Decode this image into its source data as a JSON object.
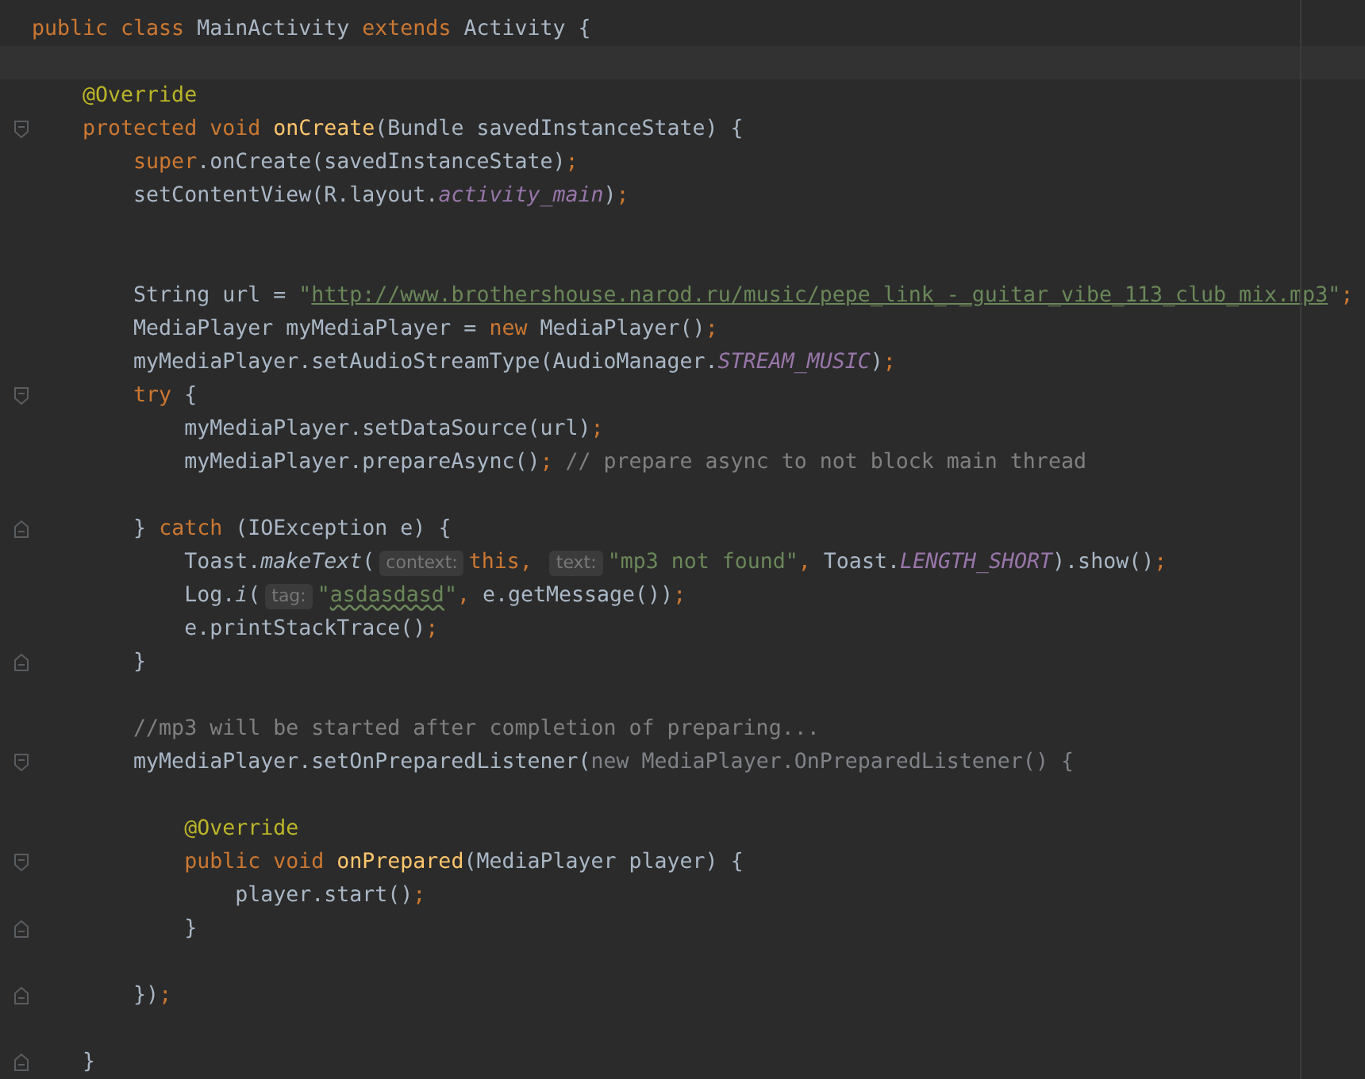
{
  "editor": {
    "lines": [
      {
        "kind": "line",
        "tokens": [
          {
            "kind": "keyword",
            "text": "public class "
          },
          {
            "kind": "plain",
            "text": "MainActivity "
          },
          {
            "kind": "keyword",
            "text": "extends "
          },
          {
            "kind": "plain",
            "text": "Activity {"
          }
        ]
      },
      {
        "kind": "caret-line"
      },
      {
        "kind": "line",
        "tokens": [
          {
            "kind": "annotation",
            "text": "    @Override"
          }
        ]
      },
      {
        "kind": "line",
        "fold": {
          "kind": "start"
        },
        "tokens": [
          {
            "kind": "keyword",
            "text": "    protected void "
          },
          {
            "kind": "declaration",
            "text": "onCreate"
          },
          {
            "kind": "plain",
            "text": "(Bundle savedInstanceState) {"
          }
        ]
      },
      {
        "kind": "line",
        "tokens": [
          {
            "kind": "keyword",
            "text": "        super"
          },
          {
            "kind": "plain",
            "text": ".onCreate(savedInstanceState)"
          },
          {
            "kind": "keyword",
            "text": ";"
          }
        ]
      },
      {
        "kind": "line",
        "tokens": [
          {
            "kind": "plain",
            "text": "        setContentView(R.layout."
          },
          {
            "kind": "constant",
            "text": "activity_main"
          },
          {
            "kind": "plain",
            "text": ")"
          },
          {
            "kind": "keyword",
            "text": ";"
          }
        ]
      },
      {
        "kind": "line"
      },
      {
        "kind": "line"
      },
      {
        "kind": "line",
        "tokens": [
          {
            "kind": "plain",
            "text": "        String url = "
          },
          {
            "kind": "string",
            "text": "\""
          },
          {
            "kind": "link",
            "text": "http://www.brothershouse.narod.ru/music/pepe_link_-_guitar_vibe_113_club_mix.mp3"
          },
          {
            "kind": "string",
            "text": "\""
          },
          {
            "kind": "keyword",
            "text": ";"
          }
        ]
      },
      {
        "kind": "line",
        "tokens": [
          {
            "kind": "plain",
            "text": "        MediaPlayer myMediaPlayer = "
          },
          {
            "kind": "keyword",
            "text": "new "
          },
          {
            "kind": "plain",
            "text": "MediaPlayer()"
          },
          {
            "kind": "keyword",
            "text": ";"
          }
        ]
      },
      {
        "kind": "line",
        "tokens": [
          {
            "kind": "plain",
            "text": "        myMediaPlayer.setAudioStreamType(AudioManager."
          },
          {
            "kind": "constant",
            "text": "STREAM_MUSIC"
          },
          {
            "kind": "plain",
            "text": ")"
          },
          {
            "kind": "keyword",
            "text": ";"
          }
        ]
      },
      {
        "kind": "line",
        "fold": {
          "kind": "start"
        },
        "tokens": [
          {
            "kind": "keyword",
            "text": "        try "
          },
          {
            "kind": "plain",
            "text": "{"
          }
        ]
      },
      {
        "kind": "line",
        "tokens": [
          {
            "kind": "plain",
            "text": "            myMediaPlayer.setDataSource(url)"
          },
          {
            "kind": "keyword",
            "text": ";"
          }
        ]
      },
      {
        "kind": "line",
        "tokens": [
          {
            "kind": "plain",
            "text": "            myMediaPlayer.prepareAsync()"
          },
          {
            "kind": "keyword",
            "text": "; "
          },
          {
            "kind": "comment",
            "text": "// prepare async to not block main thread"
          }
        ]
      },
      {
        "kind": "line"
      },
      {
        "kind": "line",
        "fold": {
          "kind": "end"
        },
        "tokens": [
          {
            "kind": "plain",
            "text": "        } "
          },
          {
            "kind": "keyword",
            "text": "catch "
          },
          {
            "kind": "plain",
            "text": "(IOException e) {"
          }
        ]
      },
      {
        "kind": "line",
        "tokens": [
          {
            "kind": "plain",
            "text": "            Toast."
          },
          {
            "kind": "static",
            "text": "makeText"
          },
          {
            "kind": "plain",
            "text": "("
          },
          {
            "kind": "hint",
            "text": "context:"
          },
          {
            "kind": "keyword",
            "text": "this, "
          },
          {
            "kind": "hint",
            "text": "text:"
          },
          {
            "kind": "string",
            "text": "\"mp3 not found\""
          },
          {
            "kind": "keyword",
            "text": ", "
          },
          {
            "kind": "plain",
            "text": "Toast."
          },
          {
            "kind": "constant",
            "text": "LENGTH_SHORT"
          },
          {
            "kind": "plain",
            "text": ").show()"
          },
          {
            "kind": "keyword",
            "text": ";"
          }
        ]
      },
      {
        "kind": "line",
        "tokens": [
          {
            "kind": "plain",
            "text": "            Log."
          },
          {
            "kind": "static",
            "text": "i"
          },
          {
            "kind": "plain",
            "text": "("
          },
          {
            "kind": "hint",
            "text": "tag:"
          },
          {
            "kind": "string",
            "text": "\""
          },
          {
            "kind": "typo",
            "text": "asdasdasd"
          },
          {
            "kind": "string",
            "text": "\""
          },
          {
            "kind": "keyword",
            "text": ", "
          },
          {
            "kind": "plain",
            "text": "e.getMessage())"
          },
          {
            "kind": "keyword",
            "text": ";"
          }
        ]
      },
      {
        "kind": "line",
        "tokens": [
          {
            "kind": "plain",
            "text": "            e.printStackTrace()"
          },
          {
            "kind": "keyword",
            "text": ";"
          }
        ]
      },
      {
        "kind": "line",
        "fold": {
          "kind": "end"
        },
        "tokens": [
          {
            "kind": "plain",
            "text": "        }"
          }
        ]
      },
      {
        "kind": "line"
      },
      {
        "kind": "line",
        "tokens": [
          {
            "kind": "comment",
            "text": "        //mp3 will be started after completion of preparing..."
          }
        ]
      },
      {
        "kind": "line",
        "fold": {
          "kind": "start"
        },
        "tokens": [
          {
            "kind": "plain",
            "text": "        myMediaPlayer.setOnPreparedListener("
          },
          {
            "kind": "dimmed",
            "text": "new MediaPlayer.OnPreparedListener() {"
          }
        ]
      },
      {
        "kind": "line"
      },
      {
        "kind": "line",
        "tokens": [
          {
            "kind": "annotation",
            "text": "            @Override"
          }
        ]
      },
      {
        "kind": "line",
        "fold": {
          "kind": "start"
        },
        "tokens": [
          {
            "kind": "keyword",
            "text": "            public void "
          },
          {
            "kind": "declaration",
            "text": "onPrepared"
          },
          {
            "kind": "plain",
            "text": "(MediaPlayer player) {"
          }
        ]
      },
      {
        "kind": "line",
        "tokens": [
          {
            "kind": "plain",
            "text": "                player.start()"
          },
          {
            "kind": "keyword",
            "text": ";"
          }
        ]
      },
      {
        "kind": "line",
        "fold": {
          "kind": "end"
        },
        "tokens": [
          {
            "kind": "plain",
            "text": "            }"
          }
        ]
      },
      {
        "kind": "line"
      },
      {
        "kind": "line",
        "fold": {
          "kind": "end"
        },
        "tokens": [
          {
            "kind": "plain",
            "text": "        })"
          },
          {
            "kind": "keyword",
            "text": ";"
          }
        ]
      },
      {
        "kind": "line"
      },
      {
        "kind": "line",
        "fold": {
          "kind": "end"
        },
        "tokens": [
          {
            "kind": "plain",
            "text": "    }"
          }
        ]
      }
    ]
  }
}
